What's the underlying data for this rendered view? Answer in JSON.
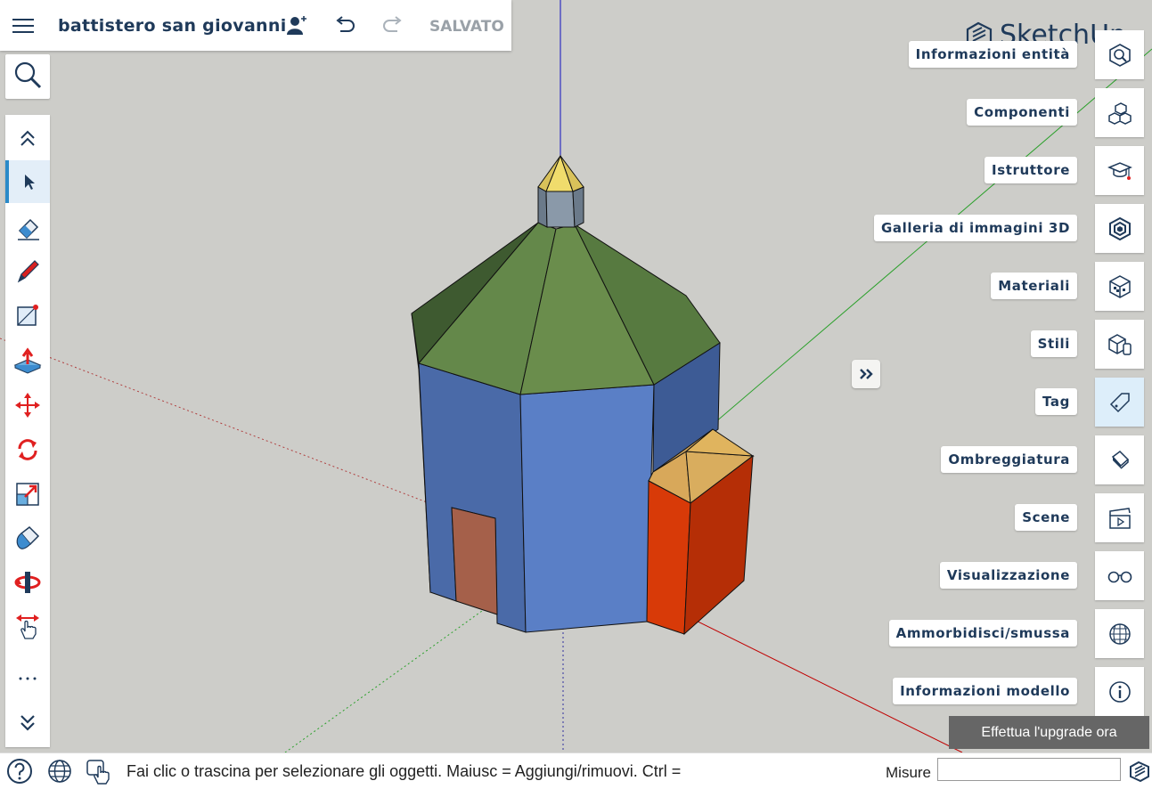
{
  "app": {
    "model_title": "battistero san giovanni",
    "save_status": "SALVATO",
    "logo_text": "SketchUp",
    "brand_color": "#1f3a5a",
    "accent_color": "#2a8ac8"
  },
  "toolbar": {
    "tools": [
      {
        "name": "chevron-up-icon"
      },
      {
        "name": "select-arrow-icon"
      },
      {
        "name": "eraser-icon"
      },
      {
        "name": "pencil-icon"
      },
      {
        "name": "rectangle-icon"
      },
      {
        "name": "push-pull-icon"
      },
      {
        "name": "move-icon"
      },
      {
        "name": "rotate-icon"
      },
      {
        "name": "scale-icon"
      },
      {
        "name": "paint-bucket-icon"
      },
      {
        "name": "orbit-icon"
      },
      {
        "name": "pan-icon"
      },
      {
        "name": "more-icon"
      },
      {
        "name": "chevron-down-icon"
      }
    ],
    "active_tool": "select-arrow-icon"
  },
  "panels": [
    {
      "label": "Informazioni entità",
      "icon": "entity-info-icon"
    },
    {
      "label": "Componenti",
      "icon": "components-icon"
    },
    {
      "label": "Istruttore",
      "icon": "instructor-icon"
    },
    {
      "label": "Galleria di immagini 3D",
      "icon": "warehouse-icon"
    },
    {
      "label": "Materiali",
      "icon": "materials-icon"
    },
    {
      "label": "Stili",
      "icon": "styles-icon"
    },
    {
      "label": "Tag",
      "icon": "tag-icon"
    },
    {
      "label": "Ombreggiatura",
      "icon": "shadows-icon"
    },
    {
      "label": "Scene",
      "icon": "scenes-icon"
    },
    {
      "label": "Visualizzazione",
      "icon": "display-icon"
    },
    {
      "label": "Ammorbidisci/smussa",
      "icon": "soften-icon"
    },
    {
      "label": "Informazioni modello",
      "icon": "model-info-icon"
    }
  ],
  "upgrade_button": "Effettua l'upgrade ora",
  "status": {
    "message": "Fai clic o trascina per selezionare gli oggetti. Maiusc = Aggiungi/rimuovi. Ctrl =",
    "measurements_label": "Misure",
    "measurements_value": ""
  }
}
